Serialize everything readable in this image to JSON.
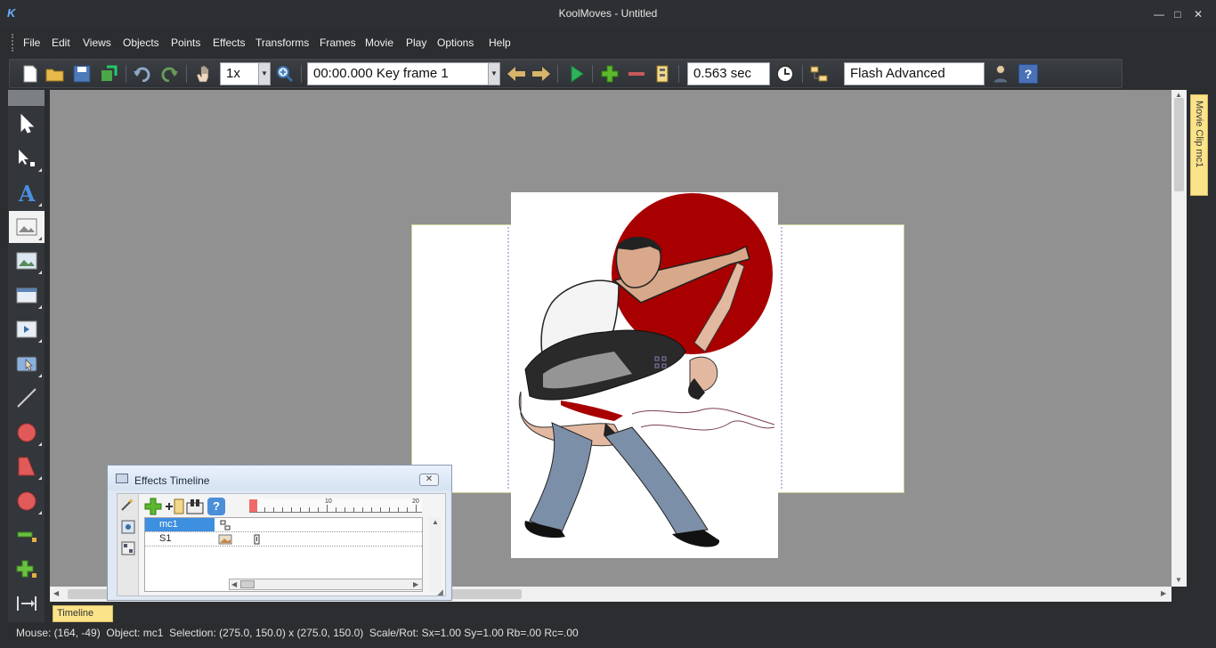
{
  "window": {
    "app_name": "KoolMoves",
    "title_separator": " - ",
    "document": "Untitled",
    "minimize": "—",
    "maximize": "□",
    "close": "✕",
    "logo": "K"
  },
  "menu": [
    "File",
    "Edit",
    "Views",
    "Objects",
    "Points",
    "Effects",
    "Transforms",
    "Frames",
    "Movie",
    "Play",
    "Options",
    "Help"
  ],
  "toolbar": {
    "zoom_value": "1x",
    "frame_value": "00:00.000  Key frame 1",
    "duration_value": "0.563 sec",
    "export_value": "Flash Advanced",
    "help_glyph": "?",
    "icons": [
      "new-file-icon",
      "open-folder-icon",
      "save-icon",
      "export-icon",
      "undo-icon",
      "redo-icon",
      "hand-icon",
      "zoom-icon",
      "prev-frame-icon",
      "next-frame-icon",
      "play-icon",
      "add-frame-icon",
      "remove-frame-icon",
      "frame-properties-icon",
      "timer-icon",
      "layers-icon",
      "user-icon",
      "help-icon"
    ]
  },
  "tools": [
    "select-arrow-icon",
    "subselect-icon",
    "text-tool-icon",
    "image-tool-icon",
    "image-edit-icon",
    "frame-tool-icon",
    "movie-clip-icon",
    "button-tool-icon",
    "line-tool-icon",
    "circle-tool-icon",
    "shape-tool-icon",
    "ellipse-tool-icon",
    "minus-tool-icon",
    "add-tool-icon",
    "motion-tool-icon"
  ],
  "side_tab": "Movie Clip mc1",
  "timeline_tab": "Timeline",
  "effects_timeline": {
    "title": "Effects Timeline",
    "close": "✕",
    "ruler_labels": [
      "10",
      "20"
    ],
    "rows": [
      {
        "name": "mc1",
        "selected": true
      },
      {
        "name": "S1",
        "selected": false
      }
    ],
    "help_glyph": "?"
  },
  "status": {
    "mouse": "Mouse: (164, -49)",
    "object": "Object: mc1",
    "selection": "Selection: (275.0, 150.0) x (275.0, 150.0)",
    "scale": "Scale/Rot: Sx=1.00 Sy=1.00 Rb=.00 Rc=.00"
  },
  "colors": {
    "accent_blue": "#3d8fe0",
    "sun_red": "#a80000",
    "tab_yellow": "#fbe38a",
    "canvas_gray": "#919191"
  }
}
